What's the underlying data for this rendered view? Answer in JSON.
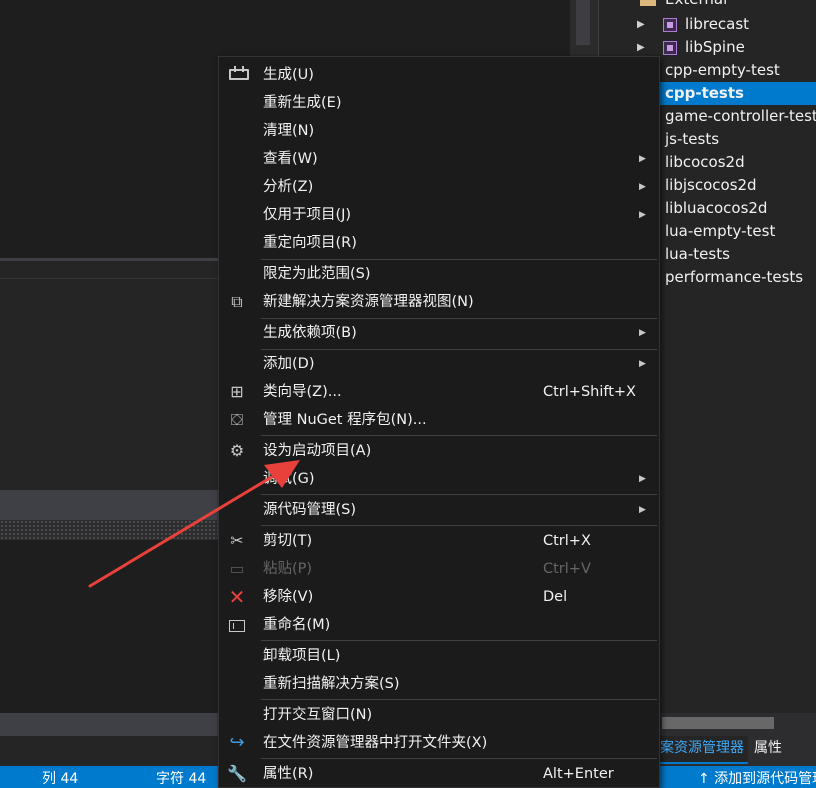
{
  "solution_explorer": {
    "folder": "External",
    "items": [
      {
        "label": "librecast",
        "type": "project",
        "expandable": true
      },
      {
        "label": "libSpine",
        "type": "project",
        "expandable": true
      },
      {
        "label": "cpp-empty-test"
      },
      {
        "label": "cpp-tests",
        "selected": true
      },
      {
        "label": "game-controller-test"
      },
      {
        "label": "js-tests"
      },
      {
        "label": "libcocos2d"
      },
      {
        "label": "libjscocos2d"
      },
      {
        "label": "libluacocos2d"
      },
      {
        "label": "lua-empty-test"
      },
      {
        "label": "lua-tests"
      },
      {
        "label": "performance-tests"
      }
    ],
    "tab_active": "解决方案资源管理器",
    "tab_properties": "属性"
  },
  "status_bar": {
    "col": "列 44",
    "char": "字符 44",
    "add_source": "↑  添加到源代码管理"
  },
  "context_menu": {
    "items": [
      {
        "label": "生成(U)",
        "icon": "build-icon"
      },
      {
        "label": "重新生成(E)"
      },
      {
        "label": "清理(N)"
      },
      {
        "label": "查看(W)",
        "submenu": true
      },
      {
        "label": "分析(Z)",
        "submenu": true
      },
      {
        "label": "仅用于项目(J)",
        "submenu": true
      },
      {
        "label": "重定向项目(R)"
      },
      {
        "label": "限定为此范围(S)"
      },
      {
        "label": "新建解决方案资源管理器视图(N)",
        "icon": "new-view-icon"
      },
      {
        "label": "生成依赖项(B)",
        "submenu": true
      },
      {
        "label": "添加(D)",
        "submenu": true
      },
      {
        "label": "类向导(Z)...",
        "shortcut": "Ctrl+Shift+X",
        "icon": "class-wizard-icon"
      },
      {
        "label": "管理 NuGet 程序包(N)...",
        "icon": "nuget-icon"
      },
      {
        "label": "设为启动项目(A)",
        "icon": "gear-icon"
      },
      {
        "label": "调试(G)",
        "submenu": true
      },
      {
        "label": "源代码管理(S)",
        "submenu": true
      },
      {
        "label": "剪切(T)",
        "shortcut": "Ctrl+X",
        "icon": "scissors-icon"
      },
      {
        "label": "粘贴(P)",
        "shortcut": "Ctrl+V",
        "icon": "paste-icon",
        "disabled": true
      },
      {
        "label": "移除(V)",
        "shortcut": "Del",
        "icon": "remove-icon"
      },
      {
        "label": "重命名(M)",
        "icon": "rename-icon"
      },
      {
        "label": "卸载项目(L)"
      },
      {
        "label": "重新扫描解决方案(S)"
      },
      {
        "label": "打开交互窗口(N)"
      },
      {
        "label": "在文件资源管理器中打开文件夹(X)",
        "icon": "open-folder-icon"
      },
      {
        "label": "属性(R)",
        "shortcut": "Alt+Enter",
        "icon": "wrench-icon"
      }
    ]
  },
  "colors": {
    "accent": "#007acc",
    "menu_bg": "#1b1b1c",
    "annotation_arrow": "#e8413c",
    "remove_icon": "#e8413c",
    "open_folder_icon": "#3f9ae0"
  }
}
